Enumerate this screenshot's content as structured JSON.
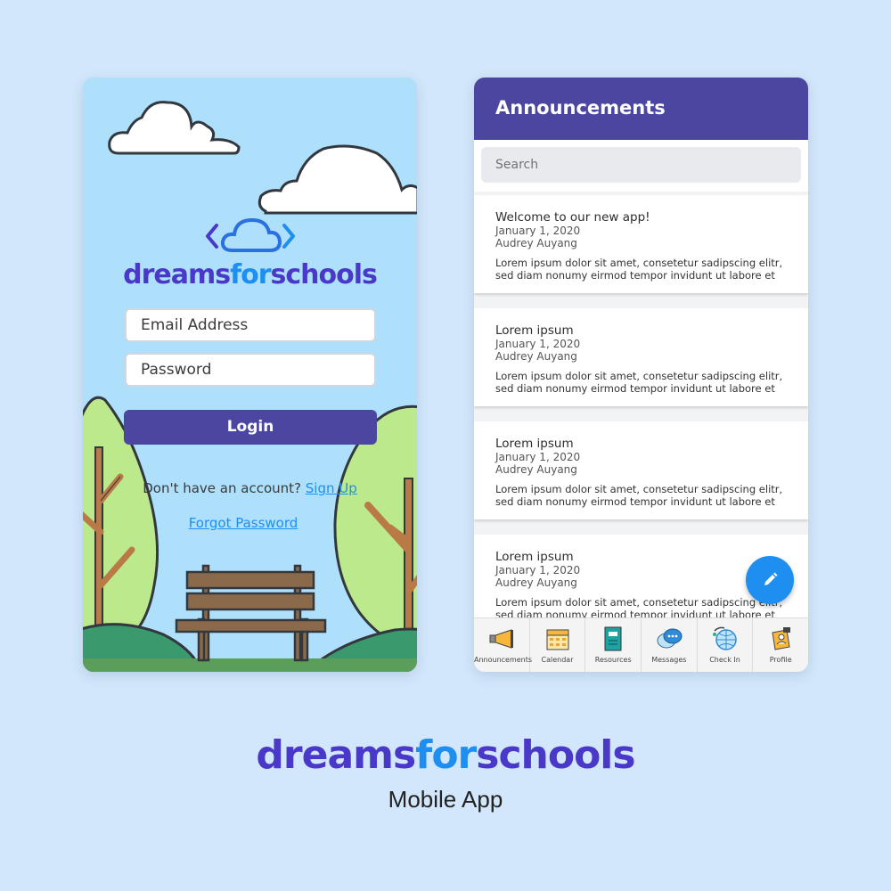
{
  "brand": {
    "part1": "dreams",
    "part2": "for",
    "part3": "schools"
  },
  "login": {
    "email_placeholder": "Email Address",
    "password_placeholder": "Password",
    "login_label": "Login",
    "no_account_text": "Don't have an account?",
    "signup_label": "Sign Up",
    "forgot_label": "Forgot Password"
  },
  "announcements": {
    "title": "Announcements",
    "search_placeholder": "Search",
    "items": [
      {
        "title": "Welcome to our new app!",
        "date": "January 1, 2020",
        "author": "Audrey Auyang",
        "body": "Lorem ipsum dolor sit amet, consetetur sadipscing elitr, sed diam nonumy eirmod tempor invidunt ut labore et"
      },
      {
        "title": "Lorem ipsum",
        "date": "January 1, 2020",
        "author": "Audrey Auyang",
        "body": "Lorem ipsum dolor sit amet, consetetur sadipscing elitr, sed diam nonumy eirmod tempor invidunt ut labore et"
      },
      {
        "title": "Lorem ipsum",
        "date": "January 1, 2020",
        "author": "Audrey Auyang",
        "body": "Lorem ipsum dolor sit amet, consetetur sadipscing elitr, sed diam nonumy eirmod tempor invidunt ut labore et"
      },
      {
        "title": "Lorem ipsum",
        "date": "January 1, 2020",
        "author": "Audrey Auyang",
        "body": "Lorem ipsum dolor sit amet, consetetur sadipscing elitr, sed diam nonumy eirmod tempor invidunt ut labore et"
      }
    ],
    "tabs": [
      {
        "label": "Announcements",
        "icon": "megaphone-icon"
      },
      {
        "label": "Calendar",
        "icon": "calendar-icon"
      },
      {
        "label": "Resources",
        "icon": "book-icon"
      },
      {
        "label": "Messages",
        "icon": "chat-bubble-icon"
      },
      {
        "label": "Check In",
        "icon": "globe-check-icon"
      },
      {
        "label": "Profile",
        "icon": "profile-badge-icon"
      }
    ],
    "fab_icon": "pencil-icon"
  },
  "footer": {
    "subtitle": "Mobile App"
  },
  "colors": {
    "primary": "#4b47a0",
    "accent_blue": "#1e8ff0",
    "brand_purple": "#4a38c9",
    "sky": "#aee0fb",
    "background": "#d2e7fb"
  }
}
